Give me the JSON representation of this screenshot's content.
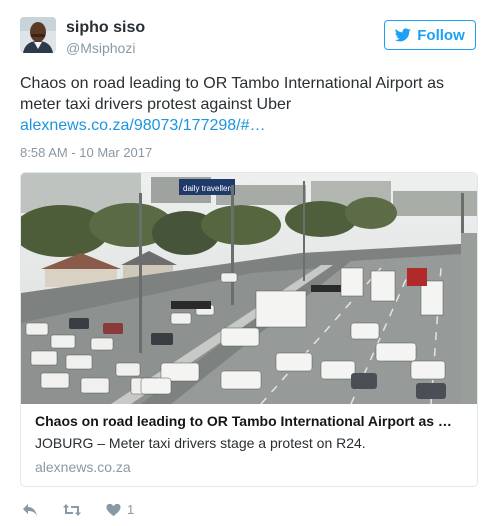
{
  "user": {
    "name": "sipho siso",
    "handle": "@Msiphozi"
  },
  "follow_button": {
    "label": "Follow"
  },
  "tweet": {
    "text": "Chaos on road leading to OR Tambo International Airport as meter taxi drivers protest against Uber",
    "link": "alexnews.co.za/98073/177298/#…",
    "timestamp": "8:58 AM - 10 Mar 2017"
  },
  "card": {
    "title": "Chaos on road leading to OR Tambo International Airport as …",
    "description": "JOBURG – Meter taxi drivers stage a protest on R24.",
    "domain": "alexnews.co.za",
    "image_overlay_text": "daily travellers"
  },
  "actions": {
    "reply_icon": "reply-icon",
    "retweet_icon": "retweet-icon",
    "like_icon": "heart-icon",
    "like_count": "1"
  },
  "colors": {
    "accent": "#1da1f2",
    "link": "#1b95e0",
    "muted": "#8899a6"
  }
}
